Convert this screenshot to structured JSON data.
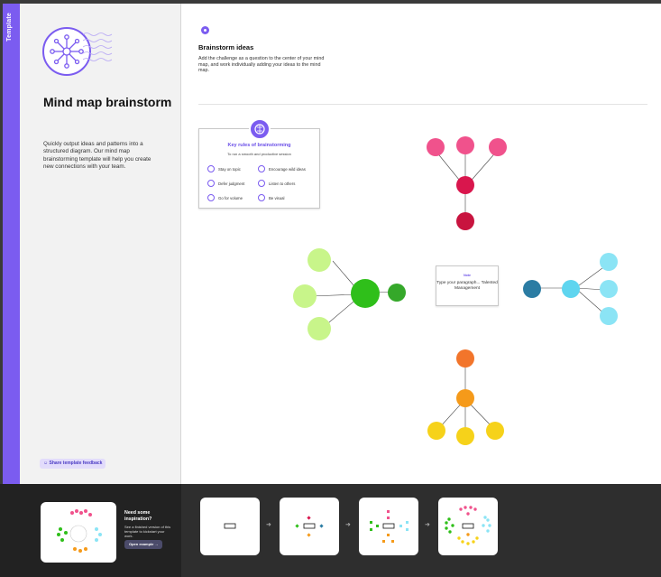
{
  "rail": {
    "label": "Template"
  },
  "left_panel": {
    "title": "Mind map brainstorm",
    "description": "Quickly output ideas and patterns into a structured diagram. Our mind map brainstorming template will help you create new connections with your team.",
    "feedback_label": "Share template feedback"
  },
  "canvas": {
    "section_title": "Brainstorm ideas",
    "section_description": "Add the challenge as a question to the center of your mind map, and work individually adding your ideas to the mind map.",
    "rules_card": {
      "title": "Key rules of brainstorming",
      "subtitle": "To run a smooth and productive session",
      "rules": [
        "Stay on topic",
        "Encourage wild ideas",
        "Defer judgment",
        "Listen to others",
        "Go for volume",
        "Be visual"
      ]
    },
    "sticky_note": {
      "label": "Note",
      "text": "Type your paragraph... Talented Management"
    },
    "colors": {
      "accent": "#7b5cf0",
      "pink": "#f0528c",
      "crimson": "#d9164d",
      "green": "#2fbf1a",
      "lime": "#c8f58a",
      "teal": "#2b7ca3",
      "cyan": "#8be4f5",
      "orange": "#f59a1a",
      "yellow": "#f6d21a"
    }
  },
  "bottom": {
    "inspiration_title": "Need some inspiration?",
    "inspiration_desc": "See a finished version of this template to kickstart your work.",
    "open_button": "Open example"
  }
}
